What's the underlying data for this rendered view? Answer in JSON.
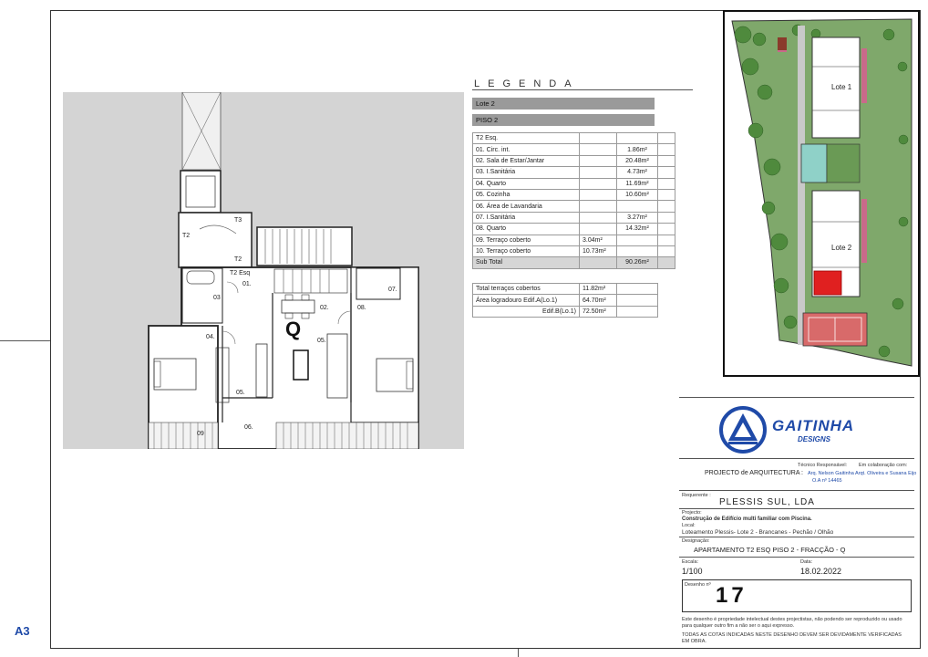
{
  "sheet": {
    "format_mark": "A3"
  },
  "plan": {
    "fraction_letter": "Q",
    "labels": [
      "T3",
      "T2",
      "T2",
      "T2 Esq",
      "01.",
      "02.",
      "03",
      "04.",
      "05.",
      "05.",
      "06.",
      "07.",
      "08.",
      "09"
    ]
  },
  "legend": {
    "title": "LEGENDA",
    "bars": [
      "Lote 2",
      "PISO 2"
    ],
    "header_row": "T2 Esq.",
    "rows": [
      {
        "name": "01. Circ. int.",
        "partial": "",
        "area": "1.86m²"
      },
      {
        "name": "02. Sala de Estar/Jantar",
        "partial": "",
        "area": "20.48m²"
      },
      {
        "name": "03. I.Sanitária",
        "partial": "",
        "area": "4.73m²"
      },
      {
        "name": "04. Quarto",
        "partial": "",
        "area": "11.69m²"
      },
      {
        "name": "05. Cozinha",
        "partial": "",
        "area": "10.60m²"
      },
      {
        "name": "06. Área de Lavandaria",
        "partial": "",
        "area": ""
      },
      {
        "name": "07. I.Sanitária",
        "partial": "",
        "area": "3.27m²"
      },
      {
        "name": "08. Quarto",
        "partial": "",
        "area": "14.32m²"
      },
      {
        "name": "09. Terraço coberto",
        "partial": "3.04m²",
        "area": ""
      },
      {
        "name": "10. Terraço coberto",
        "partial": "10.73m²",
        "area": ""
      },
      {
        "name": "Sub Total",
        "partial": "",
        "area": "90.26m²"
      }
    ],
    "totals": [
      {
        "name": "Total terraços cobertos",
        "value": "11.82m²"
      },
      {
        "name": "Área logradouro Edif.A(Lo.1)",
        "value": "64.70m²"
      },
      {
        "name": "Edif.B(Lo.1)",
        "value": "72.50m²"
      }
    ]
  },
  "site": {
    "lot_labels": [
      "Lote 1",
      "Lote 2"
    ]
  },
  "title_block": {
    "company": "GAITINHA",
    "company_sub": "DESIGNS",
    "tecnico_label": "Técnico Responsável:",
    "em_colab_label": "Em colaboração com:",
    "projecto_label": "PROJECTO de ARQUITECTURA :",
    "tecnico_name": "Arq. Nelson Gaitinha",
    "tecnico_id": "O.A nº 14465",
    "colab_name": "Arqt. Oliveira e Susana Eijo",
    "requerente_label": "Requerente :",
    "requerente": "PLESSIS SUL, LDA",
    "projecto_field_label": "Projecto:",
    "projecto": "Construção de Edifício multi familiar com Piscina.",
    "local_label": "Local:",
    "local": "Loteamento Plessis- Lote 2 - Brancanes - Pechão / Olhão",
    "designacao_label": "Designação:",
    "designacao": "APARTAMENTO T2 ESQ PISO 2 - FRACÇÃO - Q",
    "escala_label": "Escala:",
    "escala": "1/100",
    "data_label": "Data:",
    "data": "18.02.2022",
    "desenho_label": "Desenho nº",
    "desenho": "17",
    "note1": "Este desenho é propriedade intelectual destes projectistas, não podendo ser reproduzido ou usado para qualquer outro fim a não ser o aqui expresso.",
    "note2": "TODAS AS COTAS INDICADAS NESTE DESENHO DEVEM SER DEVIDAMENTE VERIFICADAS EM OBRA."
  }
}
